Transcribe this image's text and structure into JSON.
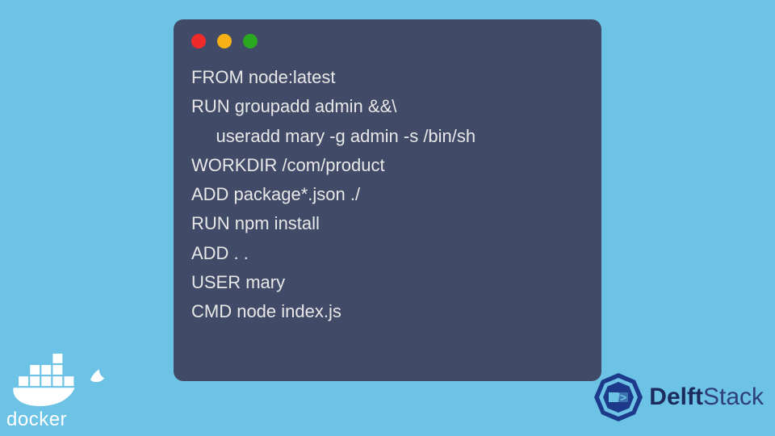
{
  "terminal": {
    "lines": [
      "FROM node:latest",
      "RUN groupadd admin &&\\",
      "     useradd mary -g admin -s /bin/sh",
      "WORKDIR /com/product",
      "ADD package*.json ./",
      "RUN npm install",
      "ADD . .",
      "USER mary",
      "CMD node index.js"
    ]
  },
  "logos": {
    "docker_label": "docker",
    "delft_label_a": "Delft",
    "delft_label_b": "Stack"
  },
  "colors": {
    "background": "#6dc3e6",
    "terminal_bg": "#414a67",
    "red": "#ee2b29",
    "yellow": "#f5b116",
    "green": "#2aa81f"
  }
}
